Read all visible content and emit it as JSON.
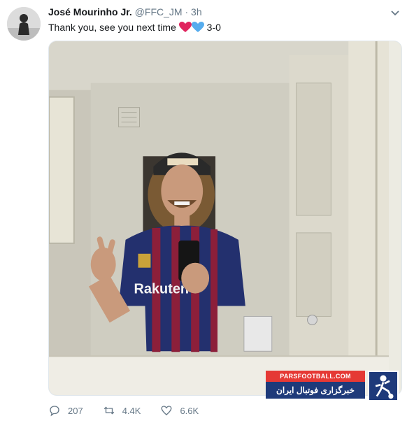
{
  "tweet": {
    "author_name": "José Mourinho Jr.",
    "handle": "@FFC_JM",
    "separator": "·",
    "time": "3h",
    "text": "Thank you, see you next time",
    "score": "3-0",
    "icons": [
      "red-heart-icon",
      "blue-heart-icon"
    ]
  },
  "watermark": {
    "site": "PARSFOOTBALL.COM",
    "tagline": "خبرگزاری فوتبال ایران"
  },
  "actions": {
    "replies": "207",
    "retweets": "4.4K",
    "likes": "6.6K"
  },
  "colors": {
    "heart_red": "#e0245e",
    "heart_blue": "#55acee",
    "muted": "#657786"
  }
}
